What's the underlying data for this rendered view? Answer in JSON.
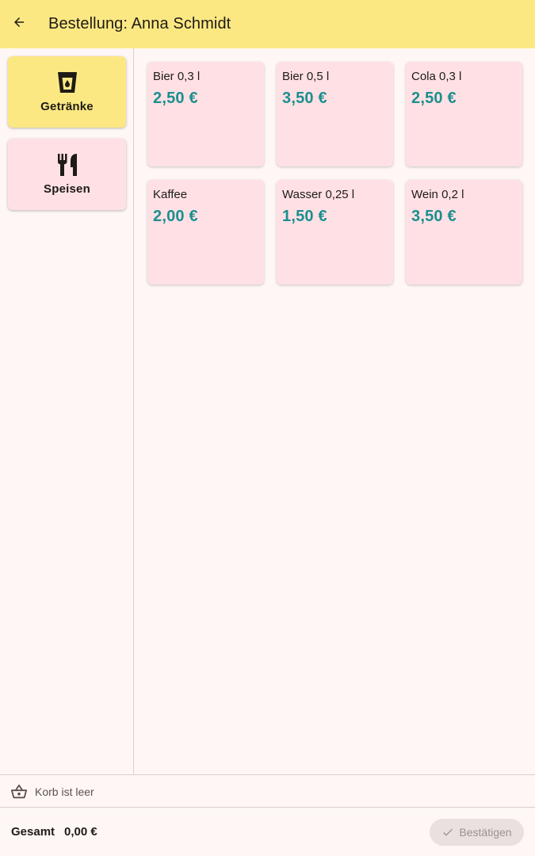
{
  "header": {
    "title": "Bestellung: Anna Schmidt",
    "back_icon": "arrow-back-icon"
  },
  "categories": [
    {
      "label": "Getränke",
      "icon": "drink-cup-icon",
      "selected": true
    },
    {
      "label": "Speisen",
      "icon": "fork-knife-icon",
      "selected": false
    }
  ],
  "products": [
    {
      "name": "Bier 0,3 l",
      "price": "2,50 €"
    },
    {
      "name": "Bier 0,5 l",
      "price": "3,50 €"
    },
    {
      "name": "Cola 0,3 l",
      "price": "2,50 €"
    },
    {
      "name": "Kaffee",
      "price": "2,00 €"
    },
    {
      "name": "Wasser 0,25 l",
      "price": "1,50 €"
    },
    {
      "name": "Wein 0,2 l",
      "price": "3,50 €"
    }
  ],
  "cart": {
    "icon": "basket-icon",
    "status": "Korb ist leer"
  },
  "footer": {
    "total_label": "Gesamt",
    "total_value": "0,00 €",
    "confirm_label": "Bestätigen",
    "confirm_icon": "check-icon",
    "confirm_enabled": false
  },
  "colors": {
    "appbar": "#fce883",
    "background": "#fff7f5",
    "card": "#ffe1e5",
    "price": "#1b8f8f",
    "selected_category": "#fce883"
  }
}
